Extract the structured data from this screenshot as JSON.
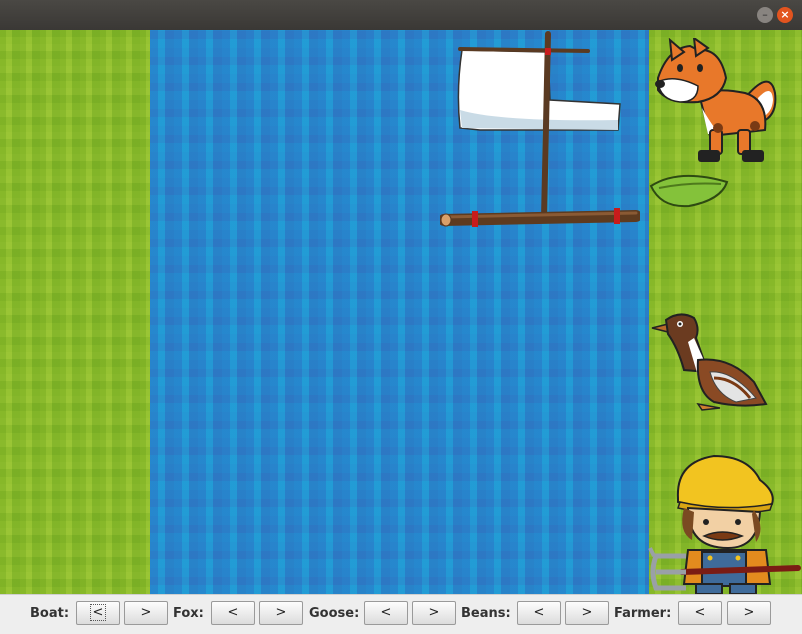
{
  "window": {
    "minimize_icon": "minimize-icon",
    "close_icon": "close-icon"
  },
  "scene": {
    "left_bank": "grass",
    "river": "water",
    "right_bank": "grass",
    "boat": "raft-with-sail",
    "right_bank_items": [
      "fox",
      "beans",
      "goose",
      "farmer"
    ]
  },
  "controls": {
    "boat": {
      "label": "Boat:",
      "left": "<",
      "right": ">"
    },
    "fox": {
      "label": "Fox:",
      "left": "<",
      "right": ">"
    },
    "goose": {
      "label": "Goose:",
      "left": "<",
      "right": ">"
    },
    "beans": {
      "label": "Beans:",
      "left": "<",
      "right": ">"
    },
    "farmer": {
      "label": "Farmer:",
      "left": "<",
      "right": ">"
    }
  },
  "colors": {
    "grass": "#8cbf2e",
    "water": "#2a8fcf",
    "titlebar": "#3a3835",
    "close": "#e2541f"
  }
}
